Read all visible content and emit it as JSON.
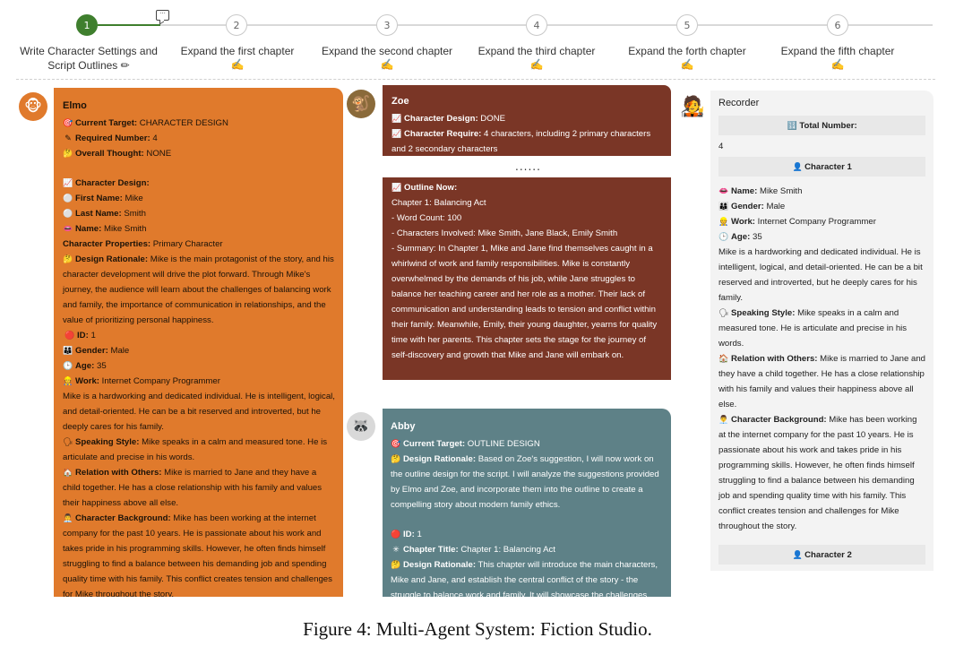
{
  "stepper": {
    "steps": [
      {
        "num": "1",
        "label": "Write Character Settings and Script Outlines",
        "icon": "pencil-icon",
        "glyph": "✏",
        "state": "active"
      },
      {
        "num": "2",
        "label": "Expand the first chapter",
        "icon": "writing-hand-icon",
        "glyph": "✍"
      },
      {
        "num": "3",
        "label": "Expand the second chapter",
        "icon": "writing-hand-icon",
        "glyph": "✍"
      },
      {
        "num": "4",
        "label": "Expand the third chapter",
        "icon": "writing-hand-icon",
        "glyph": "✍"
      },
      {
        "num": "5",
        "label": "Expand the forth chapter",
        "icon": "writing-hand-icon",
        "glyph": "✍"
      },
      {
        "num": "6",
        "label": "Expand the fifth chapter",
        "icon": "writing-hand-icon",
        "glyph": "✍"
      }
    ]
  },
  "elmo": {
    "name": "Elmo",
    "target_label": "Current Target:",
    "target_value": " CHARACTER DESIGN",
    "req_label": "Required Number:",
    "req_value": " 4",
    "thought_label": "Overall Thought:",
    "thought_value": " NONE",
    "design_label": "Character Design:",
    "first_label": "First Name:",
    "first_value": " Mike",
    "last_label": "Last Name:",
    "last_value": " Smith",
    "name_label": "Name:",
    "name_value": " Mike Smith",
    "props_label": "Character Properties:",
    "props_value": " Primary Character",
    "rationale_label": "Design Rationale:",
    "rationale_value": " Mike is the main protagonist of the story, and his character development will drive the plot forward. Through Mike's journey, the audience will learn about the challenges of balancing work and family, the importance of communication in relationships, and the value of prioritizing personal happiness.",
    "id_label": "ID:",
    "id_value": " 1",
    "gender_label": "Gender:",
    "gender_value": " Male",
    "age_label": "Age:",
    "age_value": " 35",
    "work_label": "Work:",
    "work_value": " Internet Company Programmer",
    "work_desc": "Mike is a hardworking and dedicated individual. He is intelligent, logical, and detail-oriented. He can be a bit reserved and introverted, but he deeply cares for his family.",
    "speak_label": "Speaking Style:",
    "speak_value": " Mike speaks in a calm and measured tone. He is articulate and precise in his words.",
    "rel_label": "Relation with Others:",
    "rel_value": " Mike is married to Jane and they have a child together. He has a close relationship with his family and values their happiness above all else.",
    "bg_label": "Character Background:",
    "bg_value": " Mike has been working at the internet company for the past 10 years. He is passionate about his work and takes pride in his programming skills. However, he often finds himself struggling to find a balance between his demanding job and spending quality time with his family. This conflict creates tension and challenges for Mike throughout the story."
  },
  "zoe": {
    "name": "Zoe",
    "design_label": "Character Design:",
    "design_value": " DONE",
    "require_label": "Character Require:",
    "require_value": " 4 characters, including 2 primary characters and 2 secondary characters",
    "dots": "......",
    "outline_label": "Outline Now:",
    "outline_lines": [
      "Chapter 1: Balancing Act",
      "- Word Count: 100",
      "- Characters Involved: Mike Smith, Jane Black, Emily Smith",
      "- Summary: In Chapter 1, Mike and Jane find themselves caught in a whirlwind of work and family responsibilities. Mike is constantly overwhelmed by the demands of his job, while Jane struggles to balance her teaching career and her role as a mother. Their lack of communication and understanding leads to tension and conflict within their family. Meanwhile, Emily, their young daughter, yearns for quality time with her parents. This chapter sets the stage for the journey of self-discovery and growth that Mike and Jane will embark on."
    ]
  },
  "abby": {
    "name": "Abby",
    "target_label": "Current Target:",
    "target_value": " OUTLINE DESIGN",
    "rationale_label": "Design Rationale:",
    "rationale_value": " Based on Zoe's suggestion, I will now work on the outline design for the script. I will analyze the suggestions provided by Elmo and Zoe, and incorporate them into the outline to create a compelling story about modern family ethics.",
    "id_label": "ID:",
    "id_value": " 1",
    "chapter_label": "Chapter Title:",
    "chapter_value": " Chapter 1: Balancing Act",
    "rationale2_label": "Design Rationale:",
    "rationale2_value": " This chapter will introduce the main characters, Mike and Jane, and establish the central conflict of the story - the struggle to balance work and family. It will showcase the challenges"
  },
  "recorder": {
    "name": "Recorder",
    "total_label": "Total Number:",
    "total_value": "4",
    "char1_label": "Character 1",
    "name_label": "Name:",
    "name_value": " Mike Smith",
    "gender_label": "Gender:",
    "gender_value": " Male",
    "work_label": "Work:",
    "work_value": " Internet Company Programmer",
    "age_label": "Age:",
    "age_value": " 35",
    "desc": "Mike is a hardworking and dedicated individual. He is intelligent, logical, and detail-oriented. He can be a bit reserved and introverted, but he deeply cares for his family.",
    "speak_label": "Speaking Style:",
    "speak_value": " Mike speaks in a calm and measured tone. He is articulate and precise in his words.",
    "rel_label": "Relation with Others:",
    "rel_value": " Mike is married to Jane and they have a child together. He has a close relationship with his family and values their happiness above all else.",
    "bg_label": "Character Background:",
    "bg_value": " Mike has been working at the internet company for the past 10 years. He is passionate about his work and takes pride in his programming skills. However, he often finds himself struggling to find a balance between his demanding job and spending quality time with his family. This conflict creates tension and challenges for Mike throughout the story.",
    "char2_label": "Character 2"
  },
  "caption": "Figure 4: Multi-Agent System: Fiction Studio.",
  "colors": {
    "elmo": "#e07a2c",
    "zoe": "#7a3626",
    "abby": "#5e8187",
    "recorder": "#f3f3f3",
    "step_active": "#3f7f2e"
  }
}
